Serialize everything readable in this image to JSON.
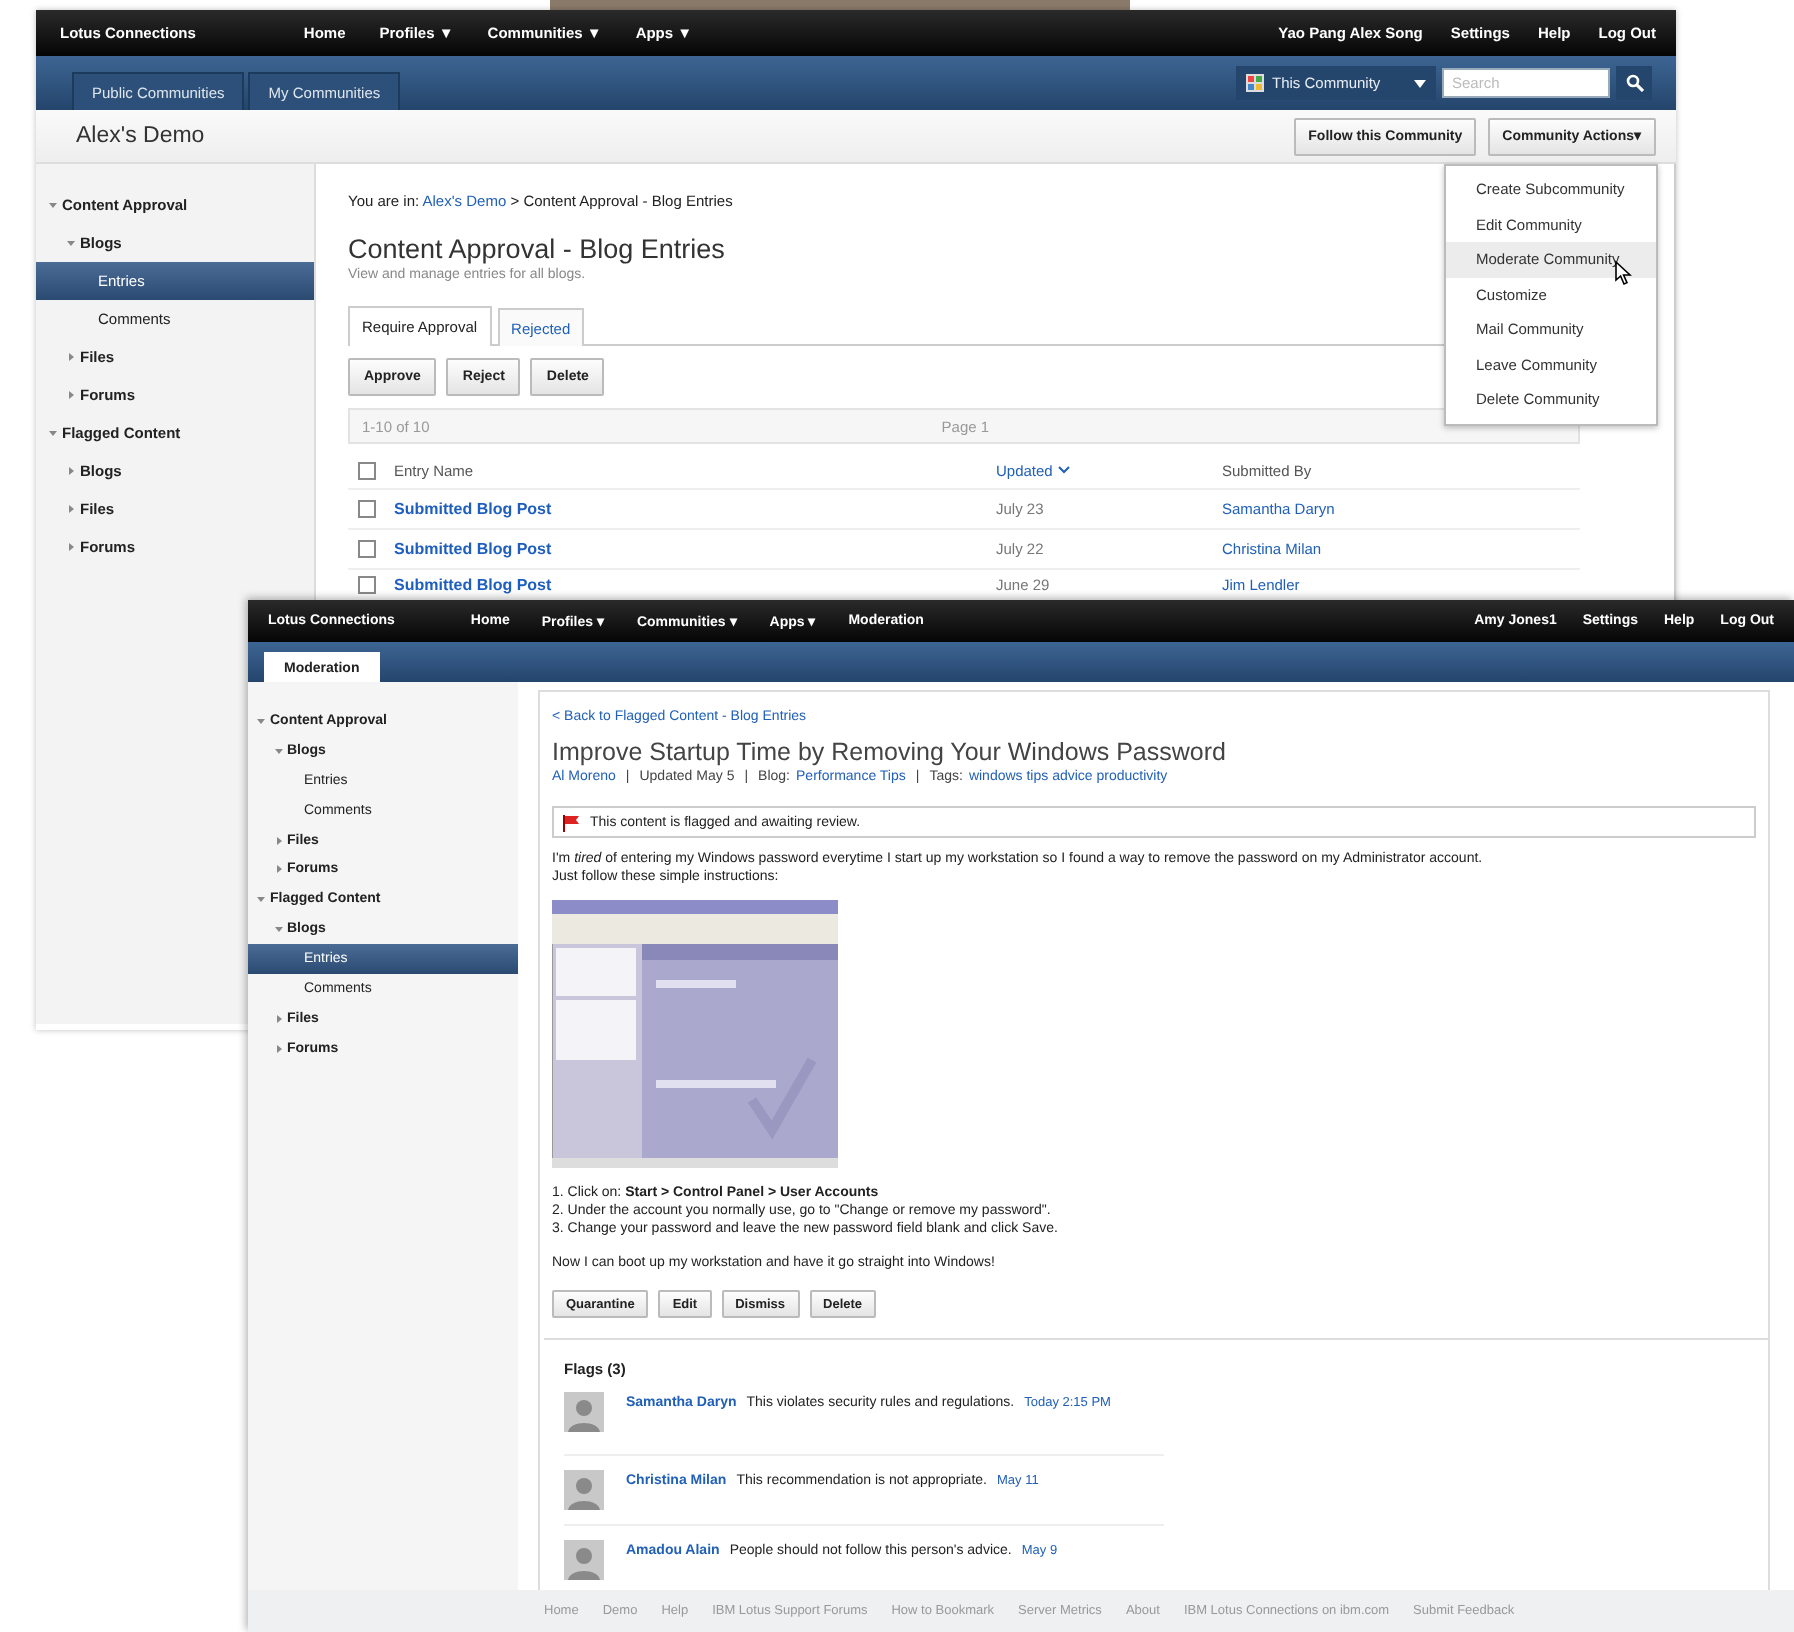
{
  "back_window": {
    "top_nav": {
      "brand": "Lotus Connections",
      "links": [
        "Home",
        "Profiles ▼",
        "Communities ▼",
        "Apps ▼"
      ],
      "user_links": [
        "Yao Pang Alex Song",
        "Settings",
        "Help",
        "Log Out"
      ]
    },
    "tabs": [
      {
        "label": "Public Communities",
        "selected": false
      },
      {
        "label": "My Communities",
        "selected": false
      }
    ],
    "scope": "This Community",
    "search": {
      "placeholder": "Search"
    },
    "title": "Alex's Demo",
    "header_buttons": [
      "Follow this Community",
      "Community Actions▾"
    ],
    "sidebar": [
      {
        "label": "Content Approval",
        "expanded": true,
        "selected": false,
        "children": [
          {
            "label": "Blogs",
            "expanded": true,
            "selected": false,
            "children": [
              {
                "label": "Entries",
                "selected": true
              },
              {
                "label": "Comments",
                "selected": false
              }
            ]
          },
          {
            "label": "Files",
            "expanded": false,
            "selected": false
          },
          {
            "label": "Forums",
            "expanded": false,
            "selected": false
          }
        ]
      },
      {
        "label": "Flagged Content",
        "expanded": true,
        "selected": false,
        "children": [
          {
            "label": "Blogs",
            "expanded": false,
            "selected": false
          },
          {
            "label": "Files",
            "expanded": false,
            "selected": false
          },
          {
            "label": "Forums",
            "expanded": false,
            "selected": false
          }
        ]
      }
    ],
    "breadcrumb": {
      "prefix": "You are in:",
      "link": "Alex's Demo",
      "rest": "> Content Approval - Blog Entries"
    },
    "heading": "Content Approval - Blog Entries",
    "subtitle": "View and manage entries for all blogs.",
    "content_tabs": [
      {
        "label": "Require Approval",
        "selected": true
      },
      {
        "label": "Rejected",
        "selected": false
      }
    ],
    "buttons": [
      "Approve",
      "Reject",
      "Delete"
    ],
    "pager": {
      "range": "1-10 of 10",
      "page": "Page  1"
    },
    "table": {
      "select_all_checked": false,
      "columns": [
        {
          "label": "Entry Name",
          "sorted": false
        },
        {
          "label": "Updated",
          "sorted": true
        },
        {
          "label": "Submitted By",
          "sorted": false
        }
      ],
      "rows": [
        {
          "checked": false,
          "entry": "Submitted Blog Post",
          "updated": "July 23",
          "submitted_by": "Samantha Daryn"
        },
        {
          "checked": false,
          "entry": "Submitted Blog Post",
          "updated": "July 22",
          "submitted_by": "Christina Milan"
        },
        {
          "checked": false,
          "entry": "Submitted Blog Post",
          "updated": "June 29",
          "submitted_by": "Jim Lendler"
        }
      ]
    },
    "actions_menu": [
      {
        "label": "Create Subcommunity",
        "selected": false
      },
      {
        "label": "Edit Community",
        "selected": false
      },
      {
        "label": "Moderate Community",
        "selected": true
      },
      {
        "label": "Customize",
        "selected": false
      },
      {
        "label": "Mail Community",
        "selected": false
      },
      {
        "label": "Leave Community",
        "selected": false
      },
      {
        "label": "Delete Community",
        "selected": false
      }
    ]
  },
  "front_window": {
    "top_nav": {
      "brand": "Lotus Connections",
      "links": [
        "Home",
        "Profiles ▾",
        "Communities ▾",
        "Apps ▾",
        "Moderation"
      ],
      "user_links": [
        "Amy Jones1",
        "Settings",
        "Help",
        "Log Out"
      ]
    },
    "tabs": [
      {
        "label": "Moderation",
        "selected": true
      }
    ],
    "sidebar": [
      {
        "label": "Content Approval",
        "expanded": true,
        "selected": false,
        "children": [
          {
            "label": "Blogs",
            "expanded": true,
            "selected": false,
            "children": [
              {
                "label": "Entries",
                "selected": false
              },
              {
                "label": "Comments",
                "selected": false
              }
            ]
          },
          {
            "label": "Files",
            "expanded": false,
            "selected": false
          },
          {
            "label": "Forums",
            "expanded": false,
            "selected": false
          }
        ]
      },
      {
        "label": "Flagged Content",
        "expanded": true,
        "selected": false,
        "children": [
          {
            "label": "Blogs",
            "expanded": true,
            "selected": false,
            "children": [
              {
                "label": "Entries",
                "selected": true
              },
              {
                "label": "Comments",
                "selected": false
              }
            ]
          },
          {
            "label": "Files",
            "expanded": false,
            "selected": false
          },
          {
            "label": "Forums",
            "expanded": false,
            "selected": false
          }
        ]
      }
    ],
    "back_link": "< Back to Flagged Content - Blog Entries",
    "title": "Improve Startup Time by Removing Your Windows Password",
    "meta": [
      {
        "kind": "link",
        "text": "Al Moreno"
      },
      {
        "kind": "separator",
        "text": "|"
      },
      {
        "kind": "text",
        "text": "Updated May 5"
      },
      {
        "kind": "separator",
        "text": "|"
      },
      {
        "kind": "labeled",
        "label": "Blog:",
        "link": "Performance Tips"
      },
      {
        "kind": "separator",
        "text": "|"
      },
      {
        "kind": "labeled",
        "label": "Tags:",
        "link": "windows tips advice productivity"
      }
    ],
    "flag_notice": "This content is flagged and awaiting review.",
    "intro": [
      "I'm *tired* of entering my Windows password everytime I start up my workstation so I found a way to remove the password on my Administrator account.",
      "Just follow these simple instructions:"
    ],
    "steps": [
      "1. Click on: **Start > Control Panel > User Accounts**",
      "2. Under the account you normally use, go to \"Change or remove my password\".",
      "3. Change your password and leave the new password field blank and click Save."
    ],
    "closing": "Now I can boot up my workstation and have it go straight into Windows!",
    "buttons": [
      "Quarantine",
      "Edit",
      "Dismiss",
      "Delete"
    ],
    "flags": {
      "title": "Flags (3)",
      "items": [
        {
          "name": "Samantha Daryn",
          "text": "This violates security rules and regulations.",
          "date": "Today 2:15 PM"
        },
        {
          "name": "Christina Milan",
          "text": "This recommendation is not appropriate.",
          "date": "May 11"
        },
        {
          "name": "Amadou Alain",
          "text": "People should not follow this person's advice.",
          "date": "May 9"
        }
      ]
    },
    "footer": [
      "Home",
      "Demo",
      "Help",
      "IBM Lotus Support Forums",
      "How to Bookmark",
      "Server Metrics",
      "About",
      "IBM Lotus Connections on ibm.com",
      "Submit Feedback"
    ]
  }
}
